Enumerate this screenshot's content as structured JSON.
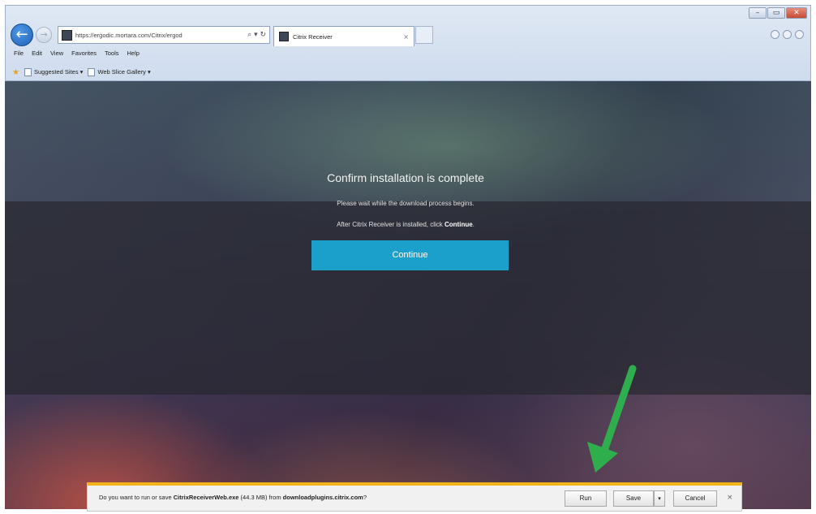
{
  "browser": {
    "url": "https://ergodic.mortara.com/Citrix/ergod",
    "url_icons": "⌕ ▾ ↻",
    "tab_title": "Citrix Receiver",
    "tab_close": "×",
    "menu": [
      "File",
      "Edit",
      "View",
      "Favorites",
      "Tools",
      "Help"
    ],
    "favorites": [
      "Suggested Sites ▾",
      "Web Slice Gallery ▾"
    ],
    "window_controls": [
      "–",
      "▭",
      "✕"
    ],
    "back": "←",
    "forward": "→"
  },
  "dialog": {
    "title": "Confirm installation is complete",
    "message1": "Please wait while the download process begins.",
    "message2_prefix": "After Citrix Receiver is installed, click ",
    "message2_bold": "Continue",
    "message2_suffix": ".",
    "button": "Continue"
  },
  "download_bar": {
    "prefix": "Do you want to run or save ",
    "file": "CitrixReceiverWeb.exe",
    "size": " (44.3 MB) from ",
    "source": "downloadplugins.citrix.com",
    "suffix": "?",
    "run": "Run",
    "save": "Save",
    "save_dropdown": "▾",
    "cancel": "Cancel",
    "close": "×"
  },
  "colors": {
    "accent_button": "#1b9fcb",
    "arrow": "#2fae4e",
    "download_bar_border": "#f3b41b"
  }
}
